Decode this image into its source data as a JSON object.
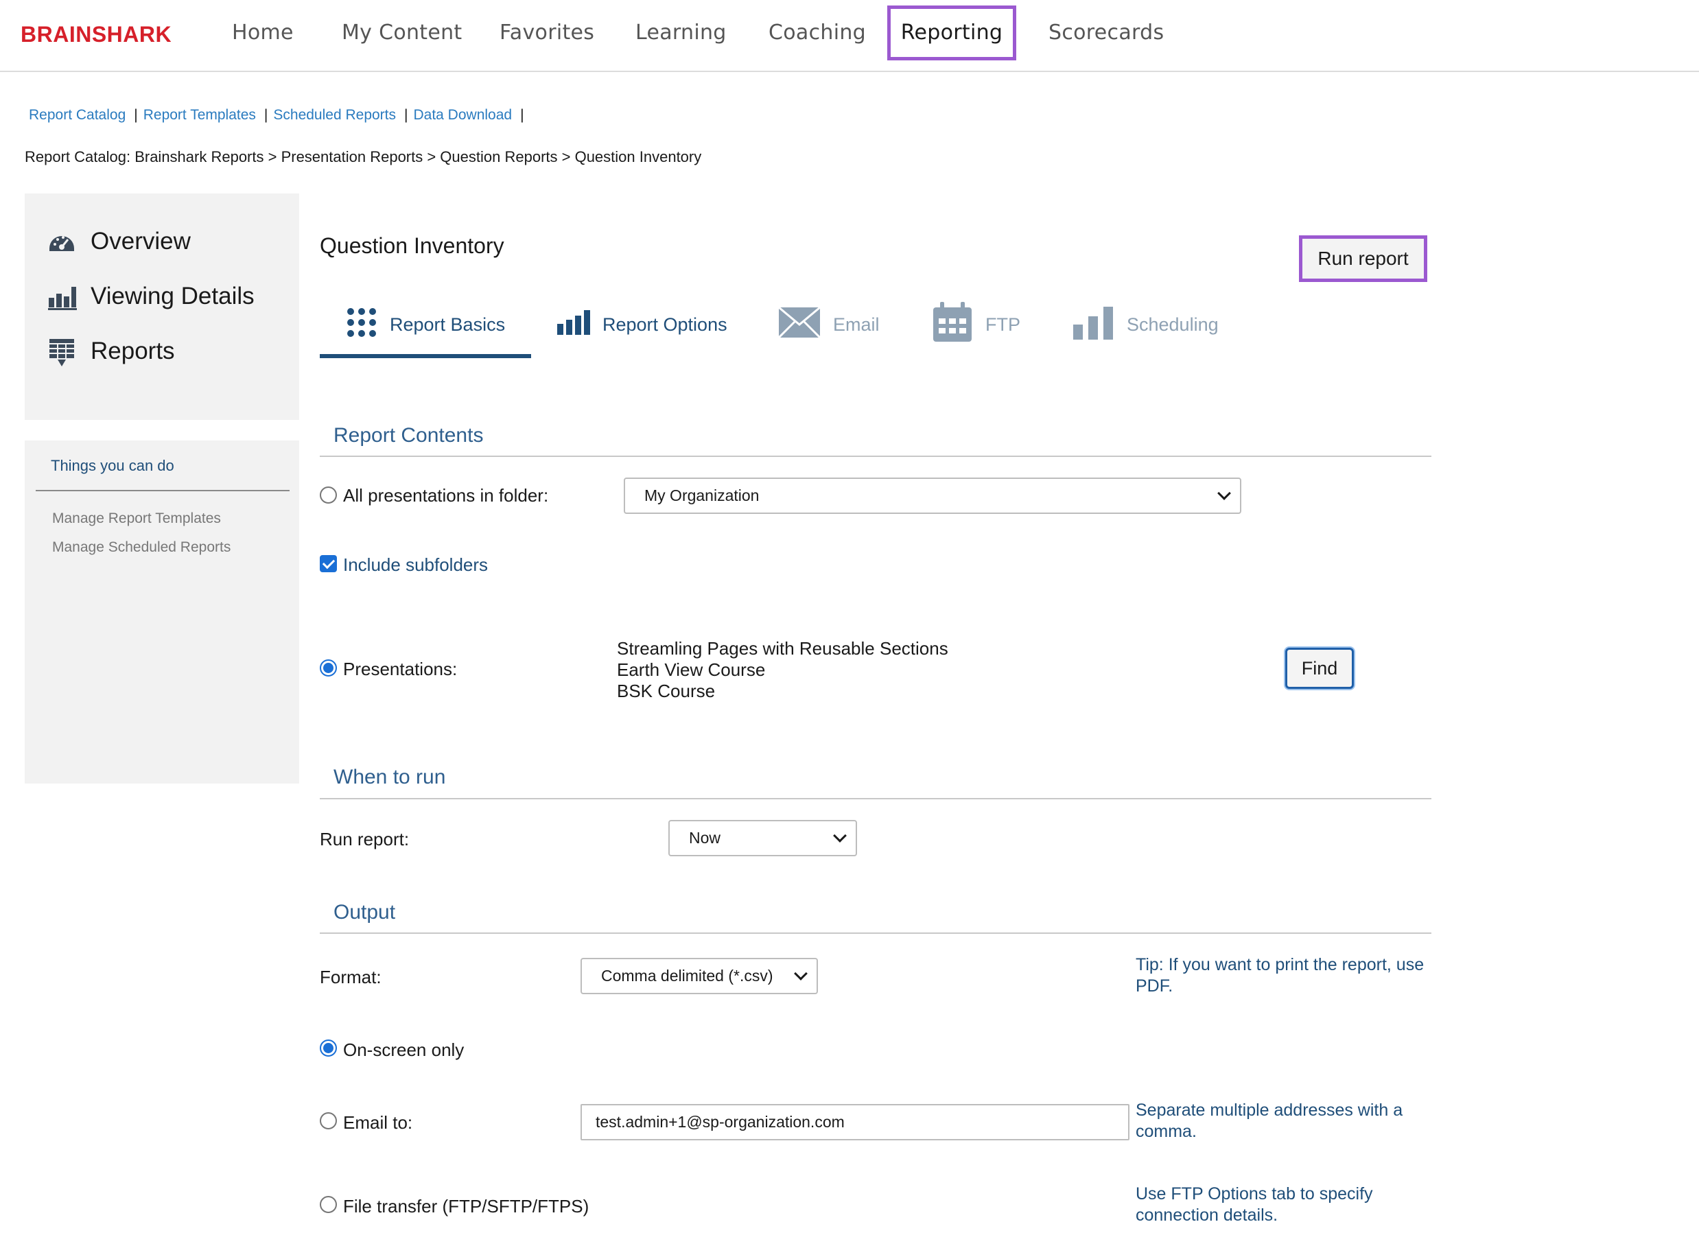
{
  "brand": {
    "logo_text": "BRAINSHARK",
    "accent": "#d6202a"
  },
  "topnav": {
    "items": [
      "Home",
      "My Content",
      "Favorites",
      "Learning",
      "Coaching",
      "Reporting",
      "Scorecards"
    ],
    "active": "Reporting",
    "highlight_color": "#9b59d0"
  },
  "sublinks": [
    "Report Catalog",
    "Report Templates",
    "Scheduled Reports",
    "Data Download"
  ],
  "breadcrumb": "Report Catalog: Brainshark Reports > Presentation Reports > Question Reports > Question Inventory",
  "sidebar": {
    "items": [
      {
        "label": "Overview",
        "icon": "dashboard-gauge-icon"
      },
      {
        "label": "Viewing Details",
        "icon": "bar-chart-icon"
      },
      {
        "label": "Reports",
        "icon": "report-table-icon"
      }
    ],
    "things": {
      "title": "Things you can do",
      "links": [
        "Manage Report Templates",
        "Manage Scheduled Reports"
      ]
    }
  },
  "main": {
    "title": "Question Inventory",
    "run_button": "Run report",
    "tabs": [
      {
        "label": "Report Basics",
        "icon": "grid-dots-icon",
        "active": true
      },
      {
        "label": "Report Options",
        "icon": "bar-chart-icon",
        "active": false
      },
      {
        "label": "Email",
        "icon": "envelope-icon",
        "active": false,
        "disabled": true
      },
      {
        "label": "FTP",
        "icon": "calendar-icon",
        "active": false,
        "disabled": true
      },
      {
        "label": "Scheduling",
        "icon": "bar-chart-icon",
        "active": false,
        "disabled": true
      }
    ],
    "report_contents": {
      "title": "Report Contents",
      "all_presentations_label": "All presentations in folder:",
      "folder_value": "My Organization",
      "include_subfolders_label": "Include subfolders",
      "include_subfolders_checked": true,
      "presentations_label": "Presentations:",
      "presentations": [
        "Streamling Pages with Reusable Sections",
        "Earth View Course",
        "BSK Course"
      ],
      "find_button": "Find"
    },
    "when_to_run": {
      "title": "When to run",
      "run_report_label": "Run report:",
      "run_value": "Now"
    },
    "output": {
      "title": "Output",
      "format_label": "Format:",
      "format_value": "Comma delimited (*.csv)",
      "format_tip": "Tip: If you want to print the report, use PDF.",
      "onscreen_label": "On-screen only",
      "email_label": "Email to:",
      "email_value": "test.admin+1@sp-organization.com",
      "email_tip": "Separate multiple addresses with a comma.",
      "ftp_label": "File transfer (FTP/SFTP/FTPS)",
      "ftp_tip": "Use FTP Options tab to specify connection details.",
      "selected": "On-screen only"
    }
  }
}
